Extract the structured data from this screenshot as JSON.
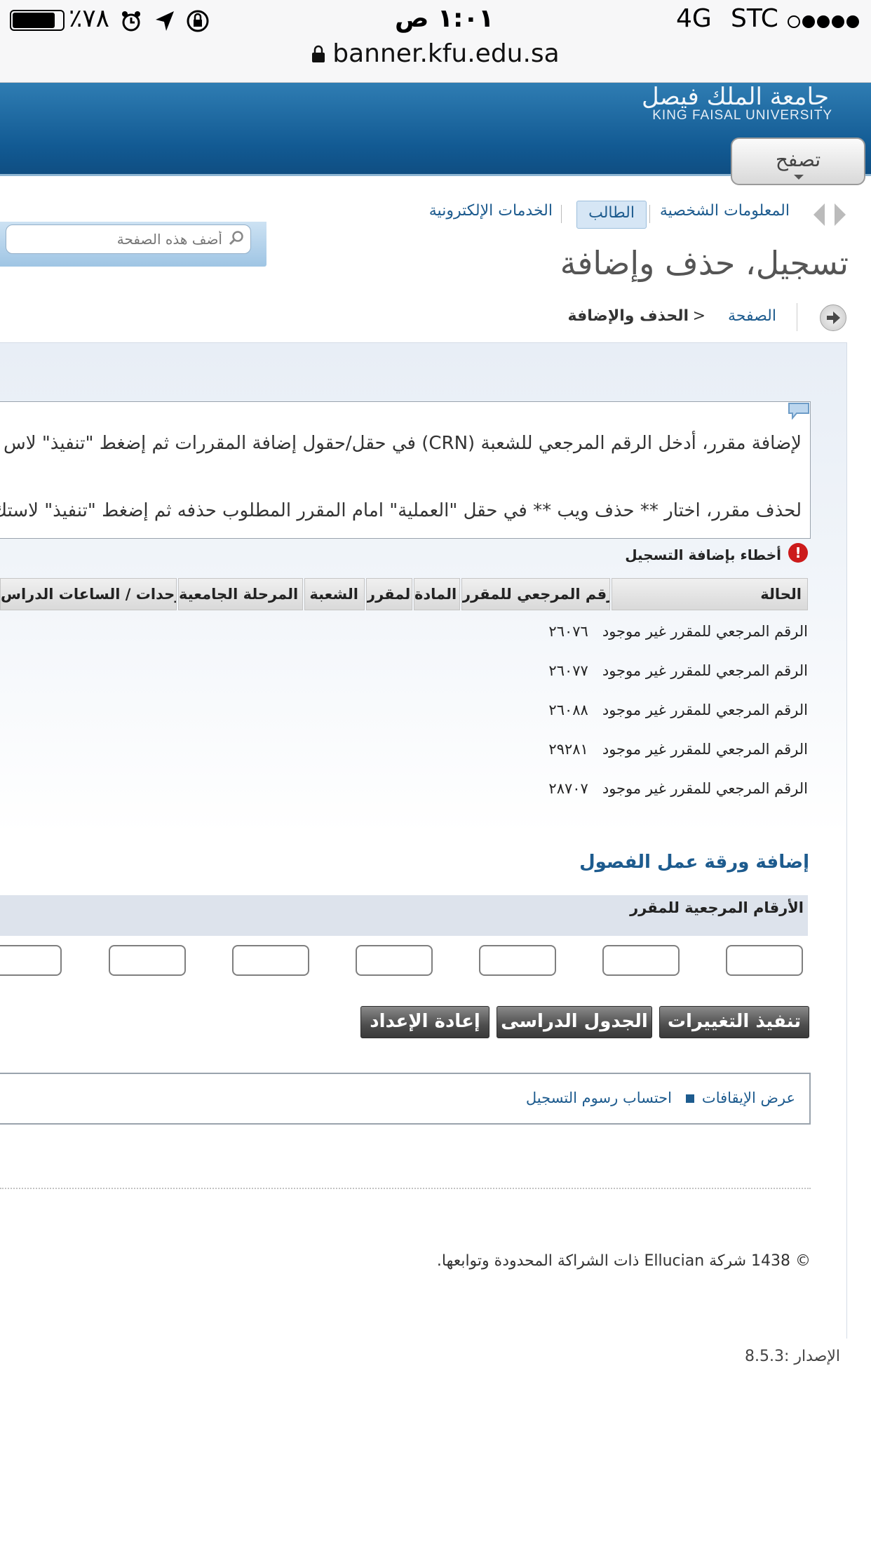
{
  "status_bar": {
    "battery": "٪٧٨",
    "time": "١:٠١ ص",
    "network": "4G",
    "carrier": "STC"
  },
  "browser": {
    "url": "banner.kfu.edu.sa"
  },
  "header": {
    "university_ar": "جامعة الملك فيصل",
    "university_en": "KING FAISAL UNIVERSITY",
    "browse_label": "تصفح",
    "brand_color": "#125a93"
  },
  "nav": {
    "tabs": [
      {
        "label": "المعلومات الشخصية"
      },
      {
        "label": "الطالب"
      },
      {
        "label": "الخدمات الإلكترونية"
      }
    ]
  },
  "search": {
    "placeholder": "أضف هذه الصفحة"
  },
  "page_title": "تسجيل، حذف وإضافة",
  "breadcrumb": {
    "home": "الصفحة",
    "separator": ">",
    "current": "الحذف والإضافة"
  },
  "info": {
    "line1": "لإضافة مقرر، أدخل الرقم المرجعي للشعبة (CRN) في حقل/حقول إضافة المقررات ثم إضغط \"تنفيذ\" لاس",
    "line2": "لحذف مقرر، اختار ** حذف ويب ** في حقل \"العملية\" امام المقرر المطلوب حذفه ثم إضغط \"تنفيذ\" لاستك"
  },
  "errors": {
    "title": "أخطاء بإضافة التسجيل",
    "icon": "!",
    "columns": [
      "الحالة",
      "الرقم المرجعي للمقرر",
      "المادة",
      "المقرر",
      "الشعبة",
      "المرحلة الجامعية",
      "الوحدات / الساعات الدراس"
    ],
    "rows": [
      {
        "status": "الرقم المرجعي للمقرر غير موجود",
        "crn": "٢٦٠٧٦"
      },
      {
        "status": "الرقم المرجعي للمقرر غير موجود",
        "crn": "٢٦٠٧٧"
      },
      {
        "status": "الرقم المرجعي للمقرر غير موجود",
        "crn": "٢٦٠٨٨"
      },
      {
        "status": "الرقم المرجعي للمقرر غير موجود",
        "crn": "٢٩٢٨١"
      },
      {
        "status": "الرقم المرجعي للمقرر غير موجود",
        "crn": "٢٨٧٠٧"
      }
    ]
  },
  "worksheet": {
    "title": "إضافة ورقة عمل الفصول",
    "crn_label": "الأرقام المرجعية للمقرر",
    "inputs": [
      "",
      "",
      "",
      "",
      "",
      "",
      ""
    ]
  },
  "buttons": {
    "submit": "تنفيذ التغييرات",
    "schedule": "الجدول الدراسى",
    "reset": "إعادة الإعداد"
  },
  "links": {
    "holds": "عرض الإيقافات",
    "fees": "احتساب رسوم التسجيل"
  },
  "footer": {
    "copyright": "© 1438 شركة Ellucian ذات الشراكة المحدودة وتوابعها.",
    "version": "الإصدار :8.5.3"
  }
}
